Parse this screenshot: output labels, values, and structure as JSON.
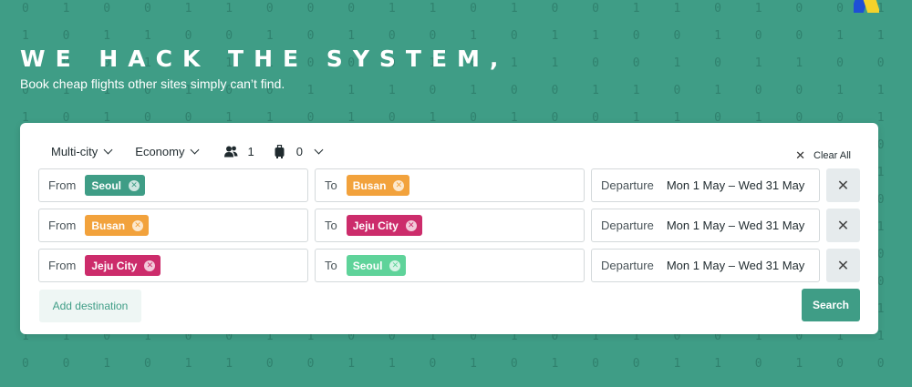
{
  "background": {
    "color": "#3f9d86",
    "binary_rows": [
      "0 1 0 0 1 1 0 0 0 1 1 0 1 0 0 1 1 0 1 0 0 1 0 1 1 0 1 0 1 1 0 0 0 1 0 1 0 0 1 0 1",
      "1 0 1 1 0 0 1 0 1 0 0 1 0 1 1 0 0 1 0 0 1 1 0 1 0 0 1 0 0 1 1 0 1 0 1 0 1 1 0 1 0",
      "1 0 0 1 0 1 1 0 0 0 1 0 1 1 0 0 1 0 1 1 0 0 0 1 1 0 0 1 0 1 0 1 1 0 0 1 0 0 1 0 1",
      "0 1 1 0 1 0 0 1 1 1 0 1 0 0 1 1 0 1 0 0 1 1 1 0 0 1 1 0 1 0 1 0 0 1 1 0 1 1 0 1 0",
      "1 0 1 0 0 1 1 0 1 0 1 0 1 0 0 1 1 0 1 0 0 1 0 1 0 1 0 1 0 1 1 0 0 1 0 1 0 0 1 1 0",
      "0 1 0 1 1 0 0 1 0 1 0 1 0 1 1 0 0 1 0 1 1 0 1 0 1 0 1 0 1 0 0 1 1 0 1 0 1 1 0 0 1",
      "1 1 0 0 1 0 1 1 0 0 1 0 0 1 0 1 1 0 0 1 0 1 0 0 1 1 0 1 0 0 1 1 0 1 0 0 1 0 1 1 0",
      "0 0 1 1 0 1 0 0 1 1 0 1 1 0 1 0 0 1 1 0 1 0 1 1 0 0 1 0 1 1 0 0 1 0 1 1 0 1 0 0 1",
      "1 0 1 1 0 0 1 0 0 1 1 0 1 0 0 1 0 1 1 0 0 1 1 0 1 0 0 1 1 0 1 0 1 0 0 1 1 0 1 0 0",
      "0 1 0 0 1 1 0 1 1 0 0 1 0 1 1 0 1 0 0 1 1 0 0 1 0 1 1 0 0 1 0 1 0 1 1 0 0 1 0 1 1",
      "1 0 0 1 0 1 1 0 1 0 1 1 0 0 1 0 1 1 0 0 1 0 1 0 1 1 0 0 1 0 1 0 1 1 0 0 1 0 1 0 1",
      "0 1 1 0 1 0 0 1 0 1 0 0 1 1 0 1 0 0 1 1 0 1 0 1 0 0 1 1 0 1 0 1 0 0 1 1 0 1 0 1 0",
      "1 1 0 1 0 0 1 1 0 0 1 0 1 0 1 1 0 0 1 0 1 1 0 0 1 0 1 0 1 1 0 0 1 0 0 1 1 0 1 0 1",
      "0 0 1 0 1 1 0 0 1 1 0 1 0 1 0 0 1 1 0 1 0 0 1 1 0 1 0 1 0 0 1 1 0 1 1 0 0 1 0 1 0"
    ]
  },
  "hero": {
    "title": "WE HACK THE SYSTEM,",
    "subtitle": "Book cheap flights other sites simply can’t find."
  },
  "search": {
    "trip_type": "Multi-city",
    "cabin_class": "Economy",
    "passengers": "1",
    "bags": "0",
    "clear_all_label": "Clear All",
    "add_destination_label": "Add destination",
    "search_label": "Search",
    "legs": [
      {
        "from_label": "From",
        "from_city": "Seoul",
        "from_color": "#3f9d86",
        "to_label": "To",
        "to_city": "Busan",
        "to_color": "#f2a23c",
        "departure_label": "Departure",
        "departure_value": "Mon 1 May – Wed 31 May"
      },
      {
        "from_label": "From",
        "from_city": "Busan",
        "from_color": "#f2a23c",
        "to_label": "To",
        "to_city": "Jeju City",
        "to_color": "#cc2c6b",
        "departure_label": "Departure",
        "departure_value": "Mon 1 May – Wed 31 May"
      },
      {
        "from_label": "From",
        "from_city": "Jeju City",
        "from_color": "#cc2c6b",
        "to_label": "To",
        "to_city": "Seoul",
        "to_color": "#5fd39a",
        "departure_label": "Departure",
        "departure_value": "Mon 1 May – Wed 31 May"
      }
    ]
  }
}
